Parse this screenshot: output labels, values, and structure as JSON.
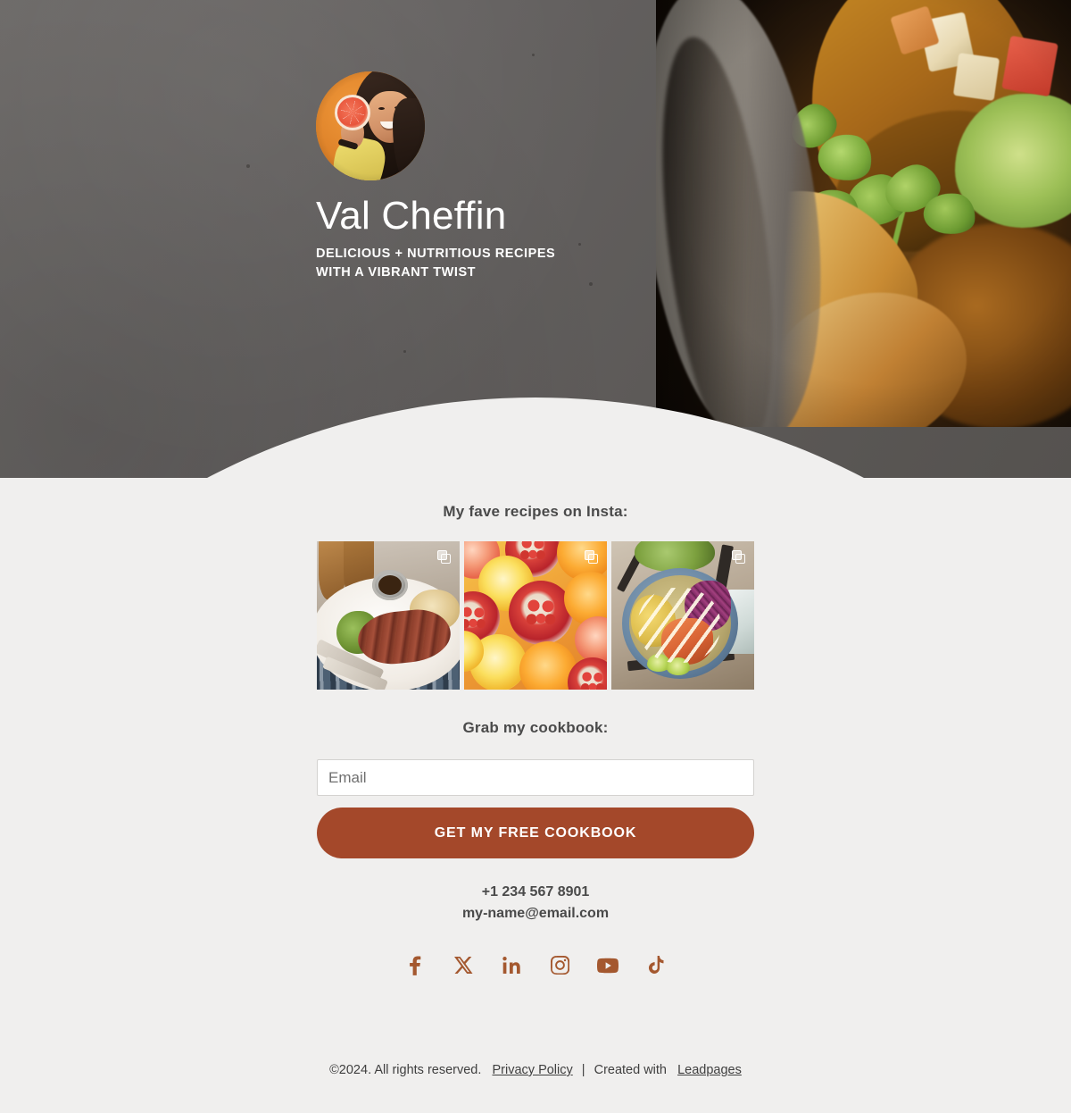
{
  "hero": {
    "name": "Val Cheffin",
    "tagline": "DELICIOUS + NUTRITIOUS RECIPES\nWITH A VIBRANT TWIST",
    "tagline_line1": "DELICIOUS + NUTRITIOUS RECIPES",
    "tagline_line2": "WITH A VIBRANT TWIST",
    "avatar_alt": "Smiling woman with long dark braided hair in a yellow jacket holding a halved grapefruit on an orange background",
    "background_alt": "Close-up of roasted squash, potato wedges, cilantro and lettuce in a dark bowl",
    "background_color": "#636160"
  },
  "insta": {
    "heading": "My fave recipes on Insta:",
    "posts": [
      {
        "alt": "Sliced grilled steak on a white plate with broccoli, rice and a cup of sauce",
        "badge": "carousel-icon"
      },
      {
        "alt": "Flat lay of sliced lemons, oranges, grapefruit and pomegranate halves",
        "badge": "carousel-icon"
      },
      {
        "alt": "Blue bowl with shrimp, red cabbage, corn, avocado and lime wedges",
        "badge": "carousel-icon"
      }
    ]
  },
  "form": {
    "heading": "Grab my cookbook:",
    "email_placeholder": "Email",
    "email_value": "",
    "submit_label": "GET MY FREE COOKBOOK",
    "submit_color": "#a4482a"
  },
  "contact": {
    "phone": "+1 234 567 8901",
    "email": "my-name@email.com"
  },
  "socials": {
    "color": "#a4582f",
    "items": [
      {
        "name": "facebook",
        "label": "Facebook"
      },
      {
        "name": "x-twitter",
        "label": "X"
      },
      {
        "name": "linkedin",
        "label": "LinkedIn"
      },
      {
        "name": "instagram",
        "label": "Instagram"
      },
      {
        "name": "youtube",
        "label": "YouTube"
      },
      {
        "name": "tiktok",
        "label": "TikTok"
      }
    ]
  },
  "footer": {
    "copyright": "©2024. All rights reserved.",
    "privacy_label": "Privacy Policy",
    "separator": "|",
    "created_with": "Created with",
    "platform_label": "Leadpages"
  }
}
